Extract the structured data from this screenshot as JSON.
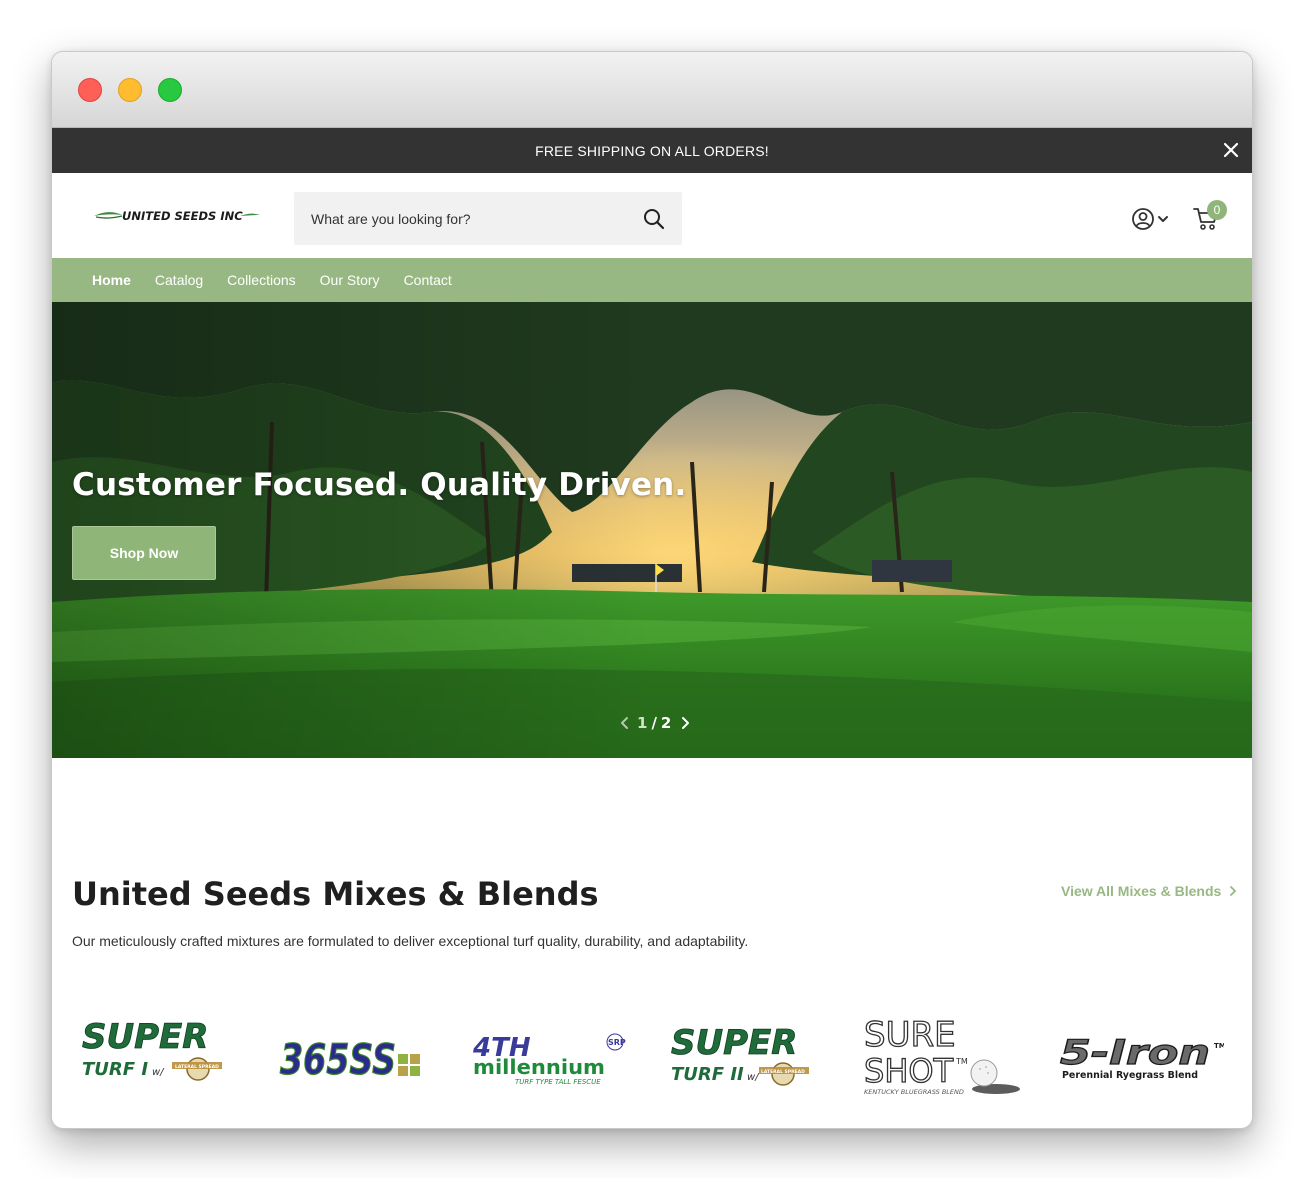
{
  "announcement": {
    "text": "FREE SHIPPING ON ALL ORDERS!"
  },
  "header": {
    "logo_text": "UNITED SEEDS INC",
    "search_placeholder": "What are you looking for?",
    "cart_count": "0"
  },
  "nav": {
    "items": [
      "Home",
      "Catalog",
      "Collections",
      "Our Story",
      "Contact"
    ],
    "active": "Home"
  },
  "hero": {
    "headline": "Customer Focused. Quality Driven.",
    "button": "Shop Now",
    "slide_current": "1",
    "slide_separator": "/",
    "slide_total": "2"
  },
  "section": {
    "title": "United Seeds Mixes & Blends",
    "view_all": "View All Mixes & Blends",
    "description": "Our meticulously crafted mixtures are formulated to deliver exceptional turf quality, durability, and adaptability."
  },
  "brands": [
    {
      "name": "SUPER",
      "sub": "TURF I",
      "extra": "w/",
      "badge": "LATERAL SPREAD"
    },
    {
      "name": "365SS"
    },
    {
      "name": "4TH",
      "sub": "millennium",
      "tag": "TURF TYPE TALL FESCUE",
      "badge": "SRP"
    },
    {
      "name": "SUPER",
      "sub": "TURF II",
      "extra": "w/",
      "badge": "LATERAL SPREAD"
    },
    {
      "name": "SURE",
      "sub": "SHOT",
      "tm": "TM",
      "tag": "KENTUCKY BLUEGRASS BLEND"
    },
    {
      "name": "5-Iron",
      "tm": "TM",
      "tag": "Perennial Ryegrass Blend"
    }
  ],
  "colors": {
    "accent": "#97b882",
    "announcement_bg": "#333333",
    "brand_green": "#1f6b3a"
  }
}
